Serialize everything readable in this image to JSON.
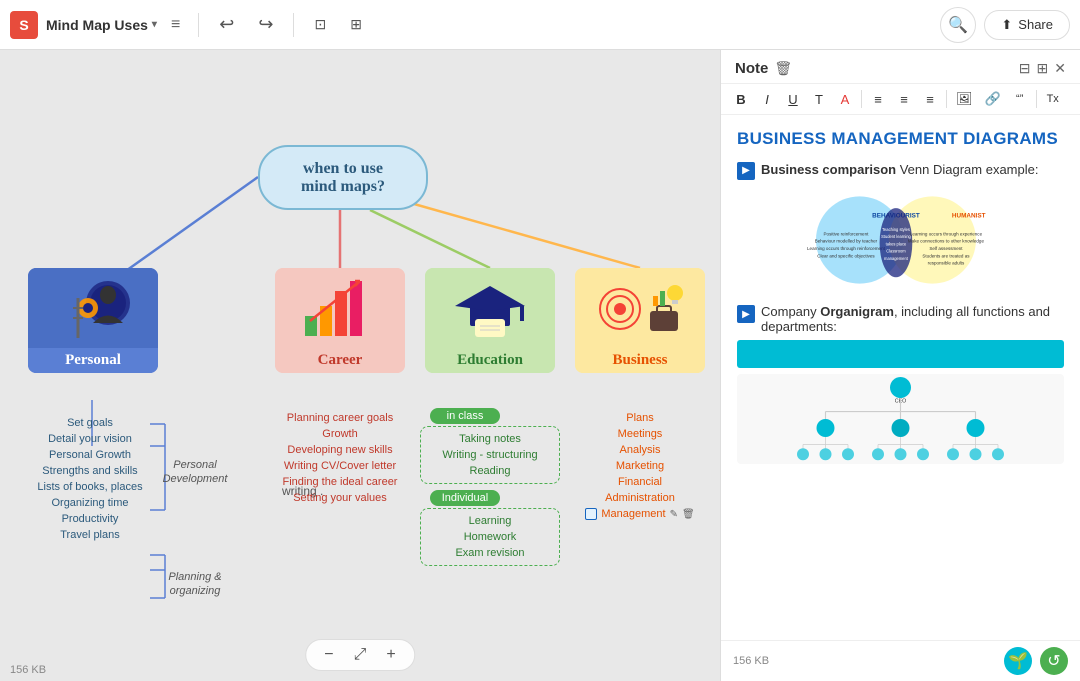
{
  "app": {
    "logo": "S",
    "title": "Mind Map Uses",
    "search_label": "🔍",
    "share_label": "Share"
  },
  "toolbar": {
    "undo": "↩",
    "redo": "↪",
    "frame": "⊡",
    "embed": "⊞",
    "menu": "≡"
  },
  "canvas": {
    "central_node": "when to use\nmind maps?",
    "zoom_out": "−",
    "zoom_fit": "⤢",
    "zoom_in": "+",
    "kb_label": "156 KB",
    "branches": [
      {
        "id": "personal",
        "label": "Personal",
        "emoji": "🧑‍🔧",
        "color": "#5a7fd4"
      },
      {
        "id": "career",
        "label": "Career",
        "emoji": "📊",
        "color": "#e57373"
      },
      {
        "id": "education",
        "label": "Education",
        "emoji": "🎓",
        "color": "#81c784"
      },
      {
        "id": "business",
        "label": "Business",
        "emoji": "💼",
        "color": "#ffb74d"
      }
    ],
    "personal_subs": [
      "Set goals",
      "Detail your vision",
      "Personal Growth",
      "Strengths and skills",
      "Lists of books, places",
      "Organizing time",
      "Productivity",
      "Travel plans"
    ],
    "personal_dev_label": "Personal\nDevelopment",
    "planning_label": "Planning &\norganizing",
    "career_subs": [
      "Planning career goals",
      "Growth",
      "Developing new skills",
      "Writing CV/Cover letter",
      "Finding the ideal career",
      "Setting your values"
    ],
    "edu_in_class_label": "in class",
    "edu_in_class_items": [
      "Taking notes",
      "Writing - structuring",
      "Reading"
    ],
    "edu_individual_label": "Individual",
    "edu_individual_items": [
      "Learning",
      "Homework",
      "Exam revision"
    ],
    "biz_subs": [
      "Plans",
      "Meetings",
      "Analysis",
      "Marketing",
      "Financial",
      "Administration",
      "Management"
    ],
    "writing_text": "writing ."
  },
  "note_panel": {
    "title": "Note",
    "main_title": "BUSINESS MANAGEMENT DIAGRAMS",
    "section1_prefix": "Business comparison",
    "section1_bold": "Business comparison",
    "section1_text": " Venn Diagram example:",
    "section2_prefix": "Company ",
    "section2_bold": "Organigram",
    "section2_text": ", including all functions and departments:",
    "kb_label": "156 KB",
    "fmt_buttons": [
      "B",
      "I",
      "U",
      "T",
      "A",
      "≡",
      "≡",
      "≡",
      "🖼",
      "🔗",
      "\"\"",
      "Tx"
    ],
    "footer_btns": [
      "🌱",
      "↺"
    ]
  }
}
